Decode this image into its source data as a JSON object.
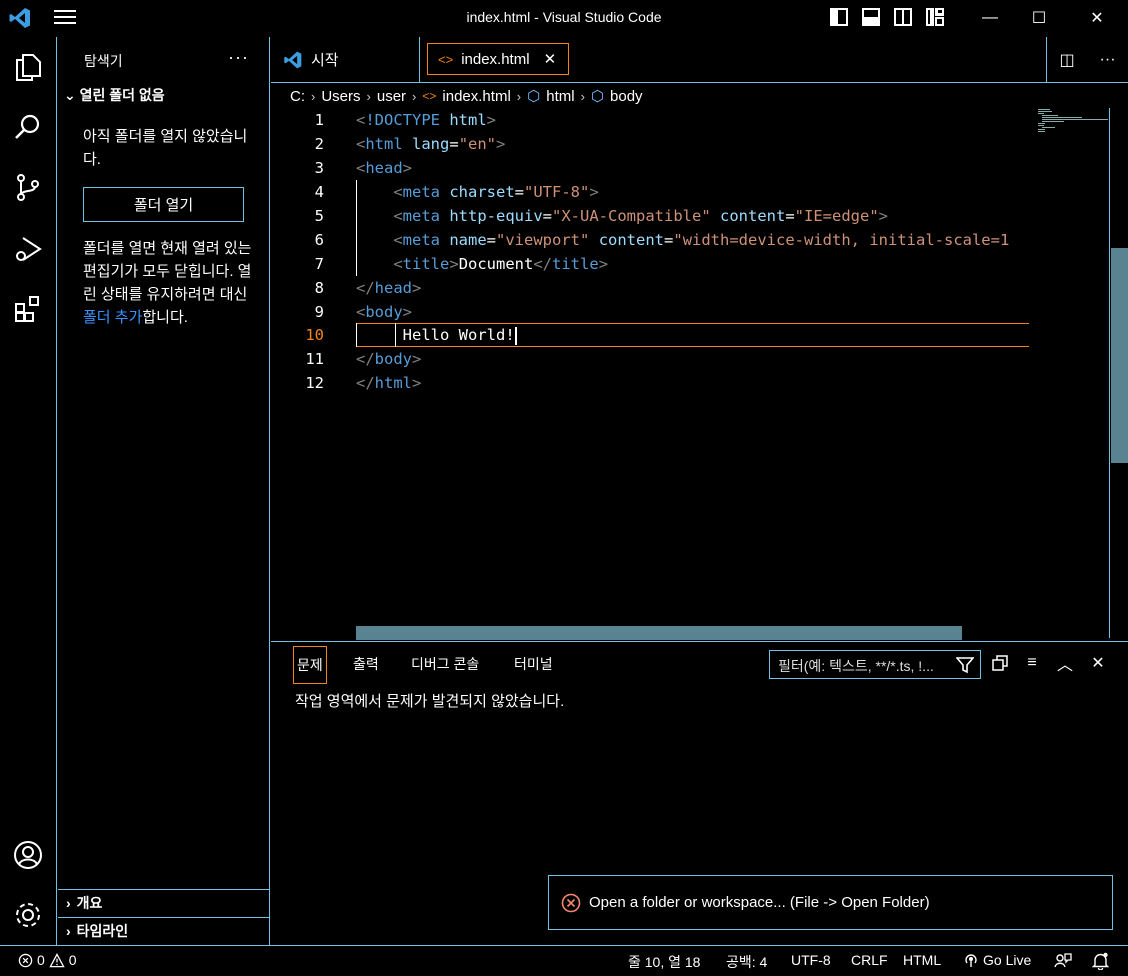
{
  "window": {
    "title": "index.html - Visual Studio Code",
    "minimize": "—",
    "maximize": "☐",
    "close": "✕"
  },
  "sidebar": {
    "title": "탐색기",
    "more": "···",
    "section": "열린 폴더 없음",
    "no_folder_text": "아직 폴더를 열지 않았습니다.",
    "open_folder_button": "폴더 열기",
    "info_text": "폴더를 열면 현재 열려 있는 편집기가 모두 닫힙니다. 열린 상태를 유지하려면 대신 ",
    "info_link": "폴더 추가",
    "info_suffix": "합니다.",
    "outline": "개요",
    "timeline": "타임라인"
  },
  "tabs": [
    {
      "label": "시작"
    },
    {
      "label": "index.html",
      "close": "✕"
    }
  ],
  "breadcrumb": [
    "C:",
    "Users",
    "user",
    "index.html",
    "html",
    "body"
  ],
  "editor": {
    "line_numbers": [
      "1",
      "2",
      "3",
      "4",
      "5",
      "6",
      "7",
      "8",
      "9",
      "10",
      "11",
      "12"
    ],
    "active_line": "10"
  },
  "panel": {
    "tabs": [
      "문제",
      "출력",
      "디버그 콘솔",
      "터미널"
    ],
    "filter_placeholder": "필터(예: 텍스트, **/*.ts, !...",
    "message": "작업 영역에서 문제가 발견되지 않았습니다."
  },
  "notification": {
    "text": "Open a folder or workspace... (File -> Open Folder)"
  },
  "status": {
    "errors": "0",
    "warnings": "0",
    "position": "줄 10, 열 18",
    "spaces": "공백: 4",
    "encoding": "UTF-8",
    "eol": "CRLF",
    "language": "HTML",
    "go_live": "Go Live"
  },
  "colors": {
    "border": "#6fc3df",
    "active": "#f38518",
    "tag": "#569cd6",
    "attr": "#9cdcfe",
    "string": "#ce9178"
  }
}
